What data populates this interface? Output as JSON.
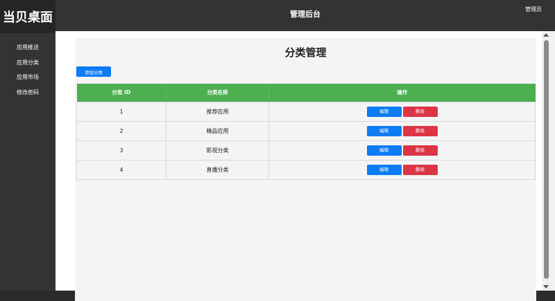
{
  "sidebar": {
    "brand": "当贝桌面",
    "items": [
      {
        "label": "应用推送"
      },
      {
        "label": "应用分类"
      },
      {
        "label": "应用市场"
      },
      {
        "label": "修改密码"
      }
    ]
  },
  "header": {
    "title": "管理后台",
    "user": "管理员"
  },
  "main": {
    "page_title": "分类管理",
    "add_button": "添加分类",
    "columns": [
      "分类 ID",
      "分类名称",
      "操作"
    ],
    "rows": [
      {
        "id": "1",
        "name": "推荐应用"
      },
      {
        "id": "2",
        "name": "精品应用"
      },
      {
        "id": "3",
        "name": "影视分类"
      },
      {
        "id": "4",
        "name": "直播分类"
      }
    ],
    "edit_label": "编辑",
    "delete_label": "删除"
  },
  "colors": {
    "header_bg": "#333333",
    "table_header": "#4caf50",
    "primary": "#0d7cf2",
    "danger": "#dc3545"
  }
}
